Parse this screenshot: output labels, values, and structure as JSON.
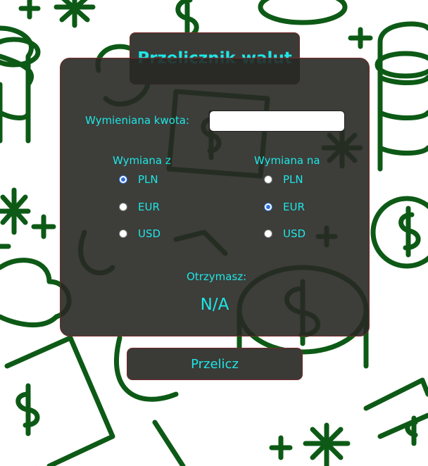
{
  "title": "Przelicznik walut",
  "amount": {
    "label": "Wymieniana kwota:",
    "value": ""
  },
  "from": {
    "label": "Wymiana z",
    "options": [
      "PLN",
      "EUR",
      "USD"
    ],
    "selected": "PLN"
  },
  "to": {
    "label": "Wymiana na",
    "options": [
      "PLN",
      "EUR",
      "USD"
    ],
    "selected": "EUR"
  },
  "result": {
    "label": "Otrzymasz:",
    "value": "N/A"
  },
  "button": {
    "label": "Przelicz"
  },
  "colors": {
    "accent": "#1ee6e6",
    "panel": "#2d2d29",
    "pattern": "#0d5a16",
    "border": "#7a2a2a"
  }
}
